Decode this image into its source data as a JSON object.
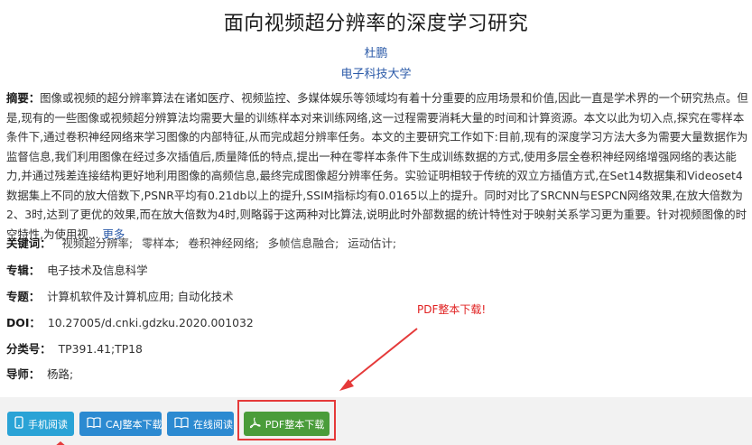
{
  "paper": {
    "title": "面向视频超分辨率的深度学习研究",
    "author": "杜鹏",
    "organization": "电子科技大学"
  },
  "abstract": {
    "label": "摘要：",
    "text": "图像或视频的超分辨率算法在诸如医疗、视频监控、多媒体娱乐等领域均有着十分重要的应用场景和价值,因此一直是学术界的一个研究热点。但是,现有的一些图像或视频超分辨算法均需要大量的训练样本对来训练网络,这一过程需要消耗大量的时间和计算资源。本文以此为切入点,探究在零样本条件下,通过卷积神经网络来学习图像的内部特征,从而完成超分辨率任务。本文的主要研究工作如下:目前,现有的深度学习方法大多为需要大量数据作为监督信息,我们利用图像在经过多次插值后,质量降低的特点,提出一种在零样本条件下生成训练数据的方式,使用多层全卷积神经网络增强网络的表达能力,并通过残差连接结构更好地利用图像的高频信息,最终完成图像超分辨率任务。实验证明相较于传统的双立方插值方式,在Set14数据集和Videoset4数据集上不同的放大倍数下,PSNR平均有0.21db以上的提升,SSIM指标均有0.0165以上的提升。同时对比了SRCNN与ESPCN网络效果,在放大倍数为2、3时,达到了更优的效果,而在放大倍数为4时,则略弱于这两种对比算法,说明此时外部数据的统计特性对于映射关系学习更为重要。针对视频图像的时空特性,为使用视...",
    "more_label": "更多"
  },
  "keywords": {
    "label": "关键词：",
    "items": [
      "视频超分辨率;",
      "零样本;",
      "卷积神经网络;",
      "多帧信息融合;",
      "运动估计;"
    ]
  },
  "major": {
    "label": "专辑：",
    "value": "电子技术及信息科学"
  },
  "topic": {
    "label": "专题：",
    "value": "计算机软件及计算机应用; 自动化技术"
  },
  "doi": {
    "label": "DOI：",
    "value": "10.27005/d.cnki.gdzku.2020.001032"
  },
  "classification": {
    "label": "分类号：",
    "value": "TP391.41;TP18"
  },
  "tutor": {
    "label": "导师：",
    "value": "杨路;"
  },
  "annotation": {
    "text": "PDF整本下载!",
    "color": "#e02020"
  },
  "buttons": {
    "mobile": "手机阅读",
    "caj": "CAJ整本下载",
    "online": "在线阅读",
    "pdf": "PDF整本下载"
  },
  "colors": {
    "link_blue": "#2b5aa8",
    "btn_blue": "#2c8ad1",
    "btn_cyan": "#2aa3d6",
    "btn_green": "#4a9c3a",
    "highlight_red": "#e53a3a"
  }
}
